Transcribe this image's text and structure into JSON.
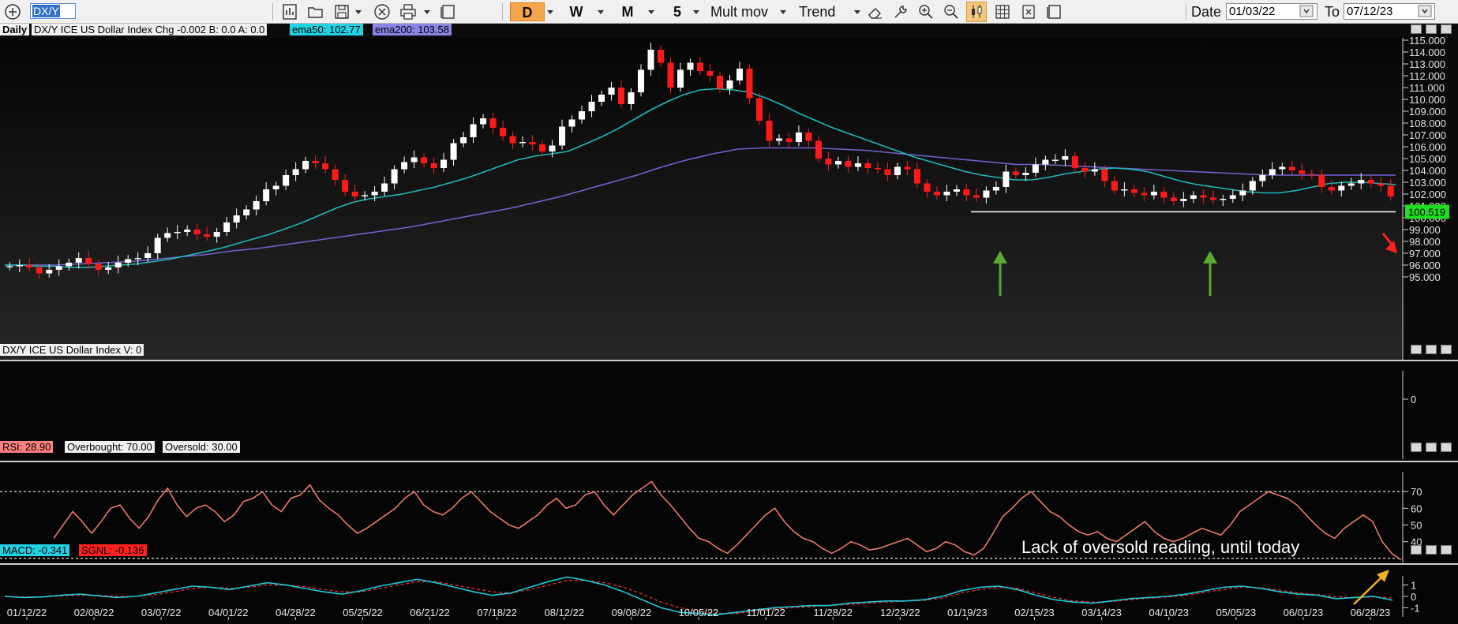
{
  "toolbar": {
    "symbol": "DX/Y",
    "periods": [
      "D",
      "W",
      "M"
    ],
    "interval": "5",
    "mult_mov": "Mult mov",
    "trend": "Trend",
    "date_label": "Date",
    "date_from": "01/03/22",
    "to_label": "To",
    "date_to": "07/12/23"
  },
  "price_panel": {
    "timeframe": "Daily",
    "header": "DX/Y  ICE US Dollar Index  Chg -0.002  B: 0.0  A: 0.0",
    "ema50_label": "ema50: 102.77",
    "ema200_label": "ema200: 103.58",
    "last_price": "100.519"
  },
  "volume_panel": {
    "header": "DX/Y  ICE US Dollar Index  V: 0",
    "axis_label": "0"
  },
  "rsi_panel": {
    "rsi_label": "RSI: 28.90",
    "overbought_label": "Overbought: 70.00",
    "oversold_label": "Oversold: 30.00"
  },
  "macd_panel": {
    "macd_label": "MACD: -0.341",
    "sgnl_label": "SGNL: -0.136"
  },
  "annotation": "Lack of oversold reading, until today",
  "colors": {
    "candle_up": "#ffffff",
    "candle_down": "#ff1a1a",
    "ema50": "#1fb8b8",
    "ema200": "#6f64d0",
    "rsi_line": "#e87a6a",
    "macd_line": "#1fc8d8",
    "signal_line": "#e03030",
    "arrow_green": "#5aa832",
    "arrow_orange": "#f0b020",
    "last_price_bg": "#22dd22"
  },
  "chart_data": [
    {
      "type": "candlestick",
      "title": "DX/Y ICE US Dollar Index",
      "x_ticks": [
        "01/12/22",
        "02/08/22",
        "03/07/22",
        "04/01/22",
        "04/28/22",
        "05/25/22",
        "06/21/22",
        "07/18/22",
        "08/12/22",
        "09/08/22",
        "10/05/22",
        "11/01/22",
        "11/28/22",
        "12/23/22",
        "01/19/23",
        "02/15/23",
        "03/14/23",
        "04/10/23",
        "05/05/23",
        "06/01/23",
        "06/28/23"
      ],
      "y_ticks": [
        "95.000",
        "96.000",
        "97.000",
        "98.000",
        "99.000",
        "100.000",
        "101.000",
        "102.000",
        "103.000",
        "104.000",
        "105.000",
        "106.000",
        "107.000",
        "108.000",
        "109.000",
        "110.000",
        "111.000",
        "112.000",
        "113.000",
        "114.000",
        "115.000"
      ],
      "ylim": [
        94.2,
        115.6
      ],
      "close_approx": [
        95.9,
        96.0,
        95.8,
        95.3,
        95.6,
        95.9,
        96.2,
        96.6,
        96.1,
        95.6,
        95.8,
        96.2,
        96.5,
        96.6,
        97.0,
        98.3,
        98.7,
        98.8,
        99.0,
        98.6,
        98.4,
        98.8,
        99.6,
        100.2,
        100.7,
        101.4,
        102.4,
        102.7,
        103.6,
        104.1,
        104.8,
        104.6,
        104.1,
        103.2,
        102.2,
        101.8,
        101.9,
        102.2,
        102.9,
        104.1,
        104.7,
        105.1,
        104.6,
        104.2,
        104.9,
        106.3,
        106.8,
        107.9,
        108.4,
        107.6,
        106.9,
        106.3,
        106.4,
        106.2,
        105.6,
        106.1,
        107.7,
        108.3,
        109.0,
        109.8,
        110.4,
        111.0,
        109.6,
        110.6,
        112.5,
        114.2,
        113.1,
        111.0,
        112.5,
        113.1,
        112.4,
        112.0,
        110.9,
        111.6,
        112.6,
        110.1,
        108.2,
        106.5,
        106.7,
        106.4,
        107.2,
        106.5,
        105.0,
        104.5,
        104.8,
        104.3,
        104.6,
        104.2,
        104.1,
        103.6,
        104.3,
        104.1,
        102.9,
        102.2,
        101.9,
        102.2,
        102.4,
        101.9,
        101.7,
        102.3,
        102.6,
        103.9,
        103.6,
        103.8,
        104.5,
        104.9,
        104.9,
        105.2,
        104.2,
        103.9,
        104.1,
        103.1,
        102.3,
        102.4,
        102.1,
        101.9,
        102.2,
        101.7,
        101.4,
        101.6,
        101.9,
        101.7,
        101.5,
        101.6,
        101.9,
        102.3,
        103.1,
        103.6,
        104.1,
        104.3,
        104.0,
        103.7,
        103.6,
        102.6,
        102.3,
        102.7,
        102.9,
        103.2,
        102.9,
        102.7,
        101.8
      ],
      "ema50_approx": [
        96.0,
        96.0,
        95.9,
        95.9,
        95.8,
        95.8,
        95.9,
        96.0,
        96.1,
        96.3,
        96.5,
        96.8,
        97.1,
        97.4,
        97.8,
        98.2,
        98.6,
        99.1,
        99.6,
        100.2,
        100.8,
        101.3,
        101.6,
        101.8,
        102.0,
        102.3,
        102.6,
        103.0,
        103.4,
        103.9,
        104.4,
        104.9,
        105.2,
        105.4,
        105.6,
        106.2,
        106.8,
        107.5,
        108.3,
        109.1,
        109.8,
        110.4,
        110.8,
        110.9,
        110.8,
        110.6,
        110.1,
        109.5,
        108.8,
        108.2,
        107.6,
        107.1,
        106.6,
        106.1,
        105.6,
        105.1,
        104.7,
        104.3,
        103.9,
        103.6,
        103.4,
        103.2,
        103.2,
        103.4,
        103.7,
        103.9,
        104.1,
        104.2,
        104.1,
        103.9,
        103.5,
        103.1,
        102.8,
        102.6,
        102.4,
        102.2,
        102.1,
        102.1,
        102.3,
        102.6,
        102.9,
        103.0,
        103.0,
        102.9,
        102.8
      ],
      "ema200_approx": [
        96.0,
        96.0,
        96.0,
        96.1,
        96.2,
        96.3,
        96.5,
        96.7,
        96.9,
        97.2,
        97.4,
        97.7,
        98.0,
        98.3,
        98.6,
        98.9,
        99.2,
        99.6,
        100.0,
        100.4,
        100.8,
        101.3,
        101.8,
        102.4,
        103.0,
        103.6,
        104.3,
        104.9,
        105.4,
        105.8,
        105.9,
        105.9,
        105.9,
        105.8,
        105.7,
        105.5,
        105.3,
        105.1,
        104.9,
        104.7,
        104.5,
        104.5,
        104.4,
        104.3,
        104.2,
        104.1,
        104.0,
        103.9,
        103.8,
        103.7,
        103.6,
        103.6,
        103.6,
        103.6,
        103.6,
        103.6
      ],
      "support_level": 100.5
    },
    {
      "type": "bar",
      "title": "Volume",
      "y_ticks": [
        "0"
      ],
      "values": []
    },
    {
      "type": "line",
      "title": "RSI",
      "y_ticks": [
        "40",
        "50",
        "60",
        "70"
      ],
      "ylim": [
        20,
        80
      ],
      "overbought": 70,
      "oversold": 30,
      "values_approx": [
        42,
        50,
        58,
        52,
        45,
        52,
        60,
        62,
        54,
        48,
        55,
        65,
        72,
        62,
        55,
        60,
        62,
        58,
        52,
        56,
        64,
        66,
        70,
        62,
        58,
        66,
        68,
        74,
        65,
        60,
        56,
        50,
        45,
        48,
        52,
        56,
        60,
        66,
        70,
        62,
        58,
        56,
        60,
        66,
        70,
        64,
        58,
        54,
        50,
        48,
        52,
        56,
        62,
        66,
        60,
        62,
        68,
        70,
        62,
        56,
        62,
        68,
        72,
        76,
        68,
        62,
        55,
        48,
        42,
        40,
        36,
        33,
        38,
        44,
        50,
        56,
        60,
        52,
        46,
        42,
        40,
        36,
        33,
        36,
        40,
        38,
        35,
        36,
        38,
        40,
        42,
        38,
        34,
        36,
        40,
        38,
        34,
        32,
        36,
        45,
        55,
        60,
        66,
        70,
        64,
        58,
        55,
        50,
        46,
        44,
        46,
        42,
        40,
        44,
        48,
        52,
        46,
        42,
        40,
        42,
        45,
        48,
        46,
        44,
        50,
        58,
        62,
        66,
        70,
        68,
        66,
        62,
        56,
        50,
        45,
        42,
        48,
        52,
        56,
        52,
        40,
        33,
        29
      ]
    },
    {
      "type": "line",
      "title": "MACD",
      "series": [
        {
          "name": "MACD",
          "values_approx": [
            0.0,
            -0.1,
            -0.05,
            0.1,
            0.2,
            0.05,
            -0.1,
            0.0,
            0.3,
            0.6,
            0.9,
            0.8,
            0.6,
            0.9,
            1.2,
            1.0,
            0.7,
            0.4,
            0.2,
            0.5,
            0.9,
            1.2,
            1.5,
            1.2,
            0.8,
            0.4,
            0.1,
            0.3,
            0.8,
            1.3,
            1.7,
            1.4,
            1.0,
            0.4,
            -0.3,
            -1.0,
            -1.4,
            -1.5,
            -1.6,
            -1.4,
            -1.2,
            -1.0,
            -0.9,
            -0.8,
            -0.8,
            -0.6,
            -0.5,
            -0.4,
            -0.4,
            -0.3,
            0.0,
            0.5,
            0.8,
            0.9,
            0.6,
            0.1,
            -0.3,
            -0.5,
            -0.6,
            -0.4,
            -0.2,
            -0.1,
            0.0,
            0.2,
            0.5,
            0.8,
            0.9,
            0.7,
            0.4,
            0.2,
            0.1,
            -0.2,
            -0.1,
            0.0,
            -0.341
          ]
        },
        {
          "name": "SGNL",
          "values_approx": [
            0.0,
            -0.05,
            -0.05,
            0.05,
            0.1,
            0.1,
            0.0,
            0.0,
            0.15,
            0.4,
            0.7,
            0.8,
            0.7,
            0.8,
            1.0,
            1.0,
            0.85,
            0.6,
            0.4,
            0.4,
            0.7,
            1.0,
            1.3,
            1.3,
            1.0,
            0.7,
            0.4,
            0.3,
            0.6,
            1.0,
            1.4,
            1.4,
            1.2,
            0.8,
            0.2,
            -0.5,
            -1.0,
            -1.3,
            -1.5,
            -1.5,
            -1.3,
            -1.1,
            -1.0,
            -0.9,
            -0.8,
            -0.7,
            -0.6,
            -0.5,
            -0.4,
            -0.35,
            -0.15,
            0.3,
            0.6,
            0.8,
            0.7,
            0.3,
            -0.1,
            -0.4,
            -0.5,
            -0.45,
            -0.3,
            -0.15,
            -0.05,
            0.1,
            0.35,
            0.6,
            0.8,
            0.75,
            0.55,
            0.3,
            0.15,
            -0.05,
            -0.1,
            -0.05,
            -0.136
          ]
        }
      ],
      "y_ticks": [
        "1",
        "0",
        "-1"
      ],
      "ylim": [
        -1.8,
        1.8
      ]
    }
  ]
}
